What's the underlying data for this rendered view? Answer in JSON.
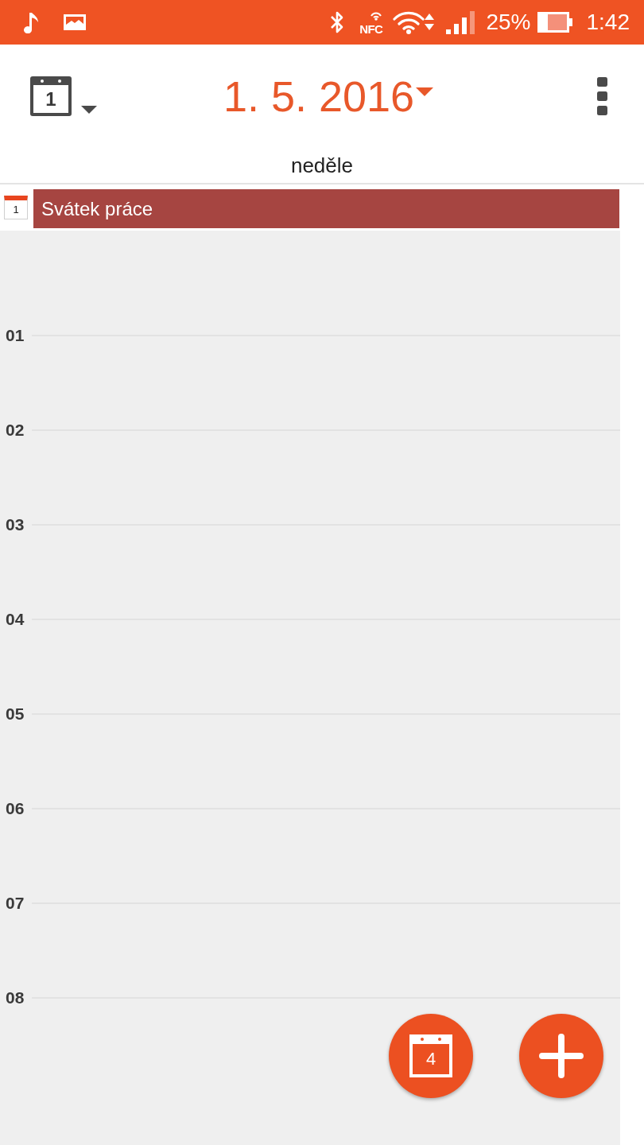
{
  "status_bar": {
    "nfc": "NFC",
    "battery_percent": "25%",
    "time": "1:42"
  },
  "toolbar": {
    "view_icon_day": "1",
    "date": "1. 5. 2016"
  },
  "day_header": {
    "weekday": "neděle"
  },
  "all_day_events": [
    {
      "icon_day": "1",
      "title": "Svátek práce",
      "color": "#a64541"
    }
  ],
  "hours": [
    {
      "label": "01"
    },
    {
      "label": "02"
    },
    {
      "label": "03"
    },
    {
      "label": "04"
    },
    {
      "label": "05"
    },
    {
      "label": "06"
    },
    {
      "label": "07"
    },
    {
      "label": "08"
    }
  ],
  "floating_buttons": [
    {
      "kind": "today",
      "day": "4"
    },
    {
      "kind": "add"
    }
  ]
}
